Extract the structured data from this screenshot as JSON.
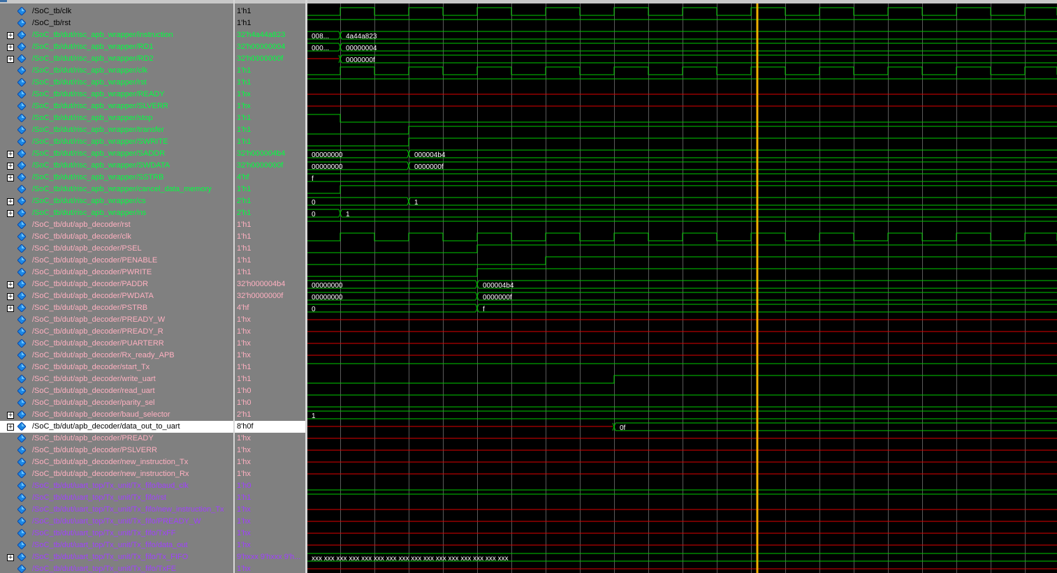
{
  "colors": {
    "high": "#00cc00",
    "low": "#00cc00",
    "x": "#e00000",
    "grid": "#5a5a5a",
    "cursor": "#f0b000",
    "bus": "#ffffff"
  },
  "icons": {
    "signal": "diamond-signal-icon",
    "expand": "plus-icon"
  },
  "expand_glyph": "+",
  "signals": [
    {
      "name": "/SoC_tb/clk",
      "value": "1'h1",
      "color": "#000000",
      "expandable": false,
      "wave": "clk"
    },
    {
      "name": "/SoC_tb/rst",
      "value": "1'h1",
      "color": "#000000",
      "expandable": false,
      "wave": "high"
    },
    {
      "name": "/SoC_tb/dut/risc_apb_wrapper/instruction",
      "value": "32'h4a44a823",
      "color": "#00ff40",
      "expandable": true,
      "wave": "bus",
      "labels": [
        "008...",
        "4a44a823"
      ]
    },
    {
      "name": "/SoC_tb/dut/risc_apb_wrapper/RD1",
      "value": "32'h00000004",
      "color": "#00ff40",
      "expandable": true,
      "wave": "bus",
      "labels": [
        "000...",
        "00000004"
      ]
    },
    {
      "name": "/SoC_tb/dut/risc_apb_wrapper/RD2",
      "value": "32'h0000000f",
      "color": "#00ff40",
      "expandable": true,
      "wave": "bus",
      "labels": [
        "",
        "0000000f"
      ]
    },
    {
      "name": "/SoC_tb/dut/risc_apb_wrapper/clk",
      "value": "1'h1",
      "color": "#00ff40",
      "expandable": false,
      "wave": "clk"
    },
    {
      "name": "/SoC_tb/dut/risc_apb_wrapper/rst",
      "value": "1'h1",
      "color": "#00ff40",
      "expandable": false,
      "wave": "high"
    },
    {
      "name": "/SoC_tb/dut/risc_apb_wrapper/READY",
      "value": "1'hx",
      "color": "#00ff40",
      "expandable": false,
      "wave": "x"
    },
    {
      "name": "/SoC_tb/dut/risc_apb_wrapper/SLVERR",
      "value": "1'hx",
      "color": "#00ff40",
      "expandable": false,
      "wave": "x"
    },
    {
      "name": "/SoC_tb/dut/risc_apb_wrapper/stop",
      "value": "1'h1",
      "color": "#00ff40",
      "expandable": false,
      "wave": "step"
    },
    {
      "name": "/SoC_tb/dut/risc_apb_wrapper/transfer",
      "value": "1'h1",
      "color": "#00ff40",
      "expandable": false,
      "wave": "step"
    },
    {
      "name": "/SoC_tb/dut/risc_apb_wrapper/SWRITE",
      "value": "1'h1",
      "color": "#00ff40",
      "expandable": false,
      "wave": "step"
    },
    {
      "name": "/SoC_tb/dut/risc_apb_wrapper/SADDR",
      "value": "32'h000004b4",
      "color": "#00ff40",
      "expandable": true,
      "wave": "bus",
      "labels": [
        "00000000",
        "000004b4"
      ]
    },
    {
      "name": "/SoC_tb/dut/risc_apb_wrapper/SWDATA",
      "value": "32'h0000000f",
      "color": "#00ff40",
      "expandable": true,
      "wave": "bus",
      "labels": [
        "00000000",
        "0000000f"
      ]
    },
    {
      "name": "/SoC_tb/dut/risc_apb_wrapper/SSTRB",
      "value": "4'hf",
      "color": "#00ff40",
      "expandable": true,
      "wave": "bus",
      "labels": [
        "f"
      ]
    },
    {
      "name": "/SoC_tb/dut/risc_apb_wrapper/cancel_data_memory",
      "value": "1'h1",
      "color": "#00ff40",
      "expandable": false,
      "wave": "step"
    },
    {
      "name": "/SoC_tb/dut/risc_apb_wrapper/cs",
      "value": "2'h1",
      "color": "#00ff40",
      "expandable": true,
      "wave": "bus",
      "labels": [
        "0",
        "1"
      ]
    },
    {
      "name": "/SoC_tb/dut/risc_apb_wrapper/ns",
      "value": "2'h1",
      "color": "#00ff40",
      "expandable": true,
      "wave": "bus",
      "labels": [
        "0",
        "1"
      ]
    },
    {
      "name": "/SoC_tb/dut/apb_decoder/rst",
      "value": "1'h1",
      "color": "#ffb0c0",
      "expandable": false,
      "wave": "high"
    },
    {
      "name": "/SoC_tb/dut/apb_decoder/clk",
      "value": "1'h1",
      "color": "#ffb0c0",
      "expandable": false,
      "wave": "clk"
    },
    {
      "name": "/SoC_tb/dut/apb_decoder/PSEL",
      "value": "1'h1",
      "color": "#ffb0c0",
      "expandable": false,
      "wave": "step"
    },
    {
      "name": "/SoC_tb/dut/apb_decoder/PENABLE",
      "value": "1'h1",
      "color": "#ffb0c0",
      "expandable": false,
      "wave": "step"
    },
    {
      "name": "/SoC_tb/dut/apb_decoder/PWRITE",
      "value": "1'h1",
      "color": "#ffb0c0",
      "expandable": false,
      "wave": "step"
    },
    {
      "name": "/SoC_tb/dut/apb_decoder/PADDR",
      "value": "32'h000004b4",
      "color": "#ffb0c0",
      "expandable": true,
      "wave": "bus",
      "labels": [
        "00000000",
        "000004b4"
      ]
    },
    {
      "name": "/SoC_tb/dut/apb_decoder/PWDATA",
      "value": "32'h0000000f",
      "color": "#ffb0c0",
      "expandable": true,
      "wave": "bus",
      "labels": [
        "00000000",
        "0000000f"
      ]
    },
    {
      "name": "/SoC_tb/dut/apb_decoder/PSTRB",
      "value": "4'hf",
      "color": "#ffb0c0",
      "expandable": true,
      "wave": "bus",
      "labels": [
        "0",
        "f"
      ]
    },
    {
      "name": "/SoC_tb/dut/apb_decoder/PREADY_W",
      "value": "1'hx",
      "color": "#ffb0c0",
      "expandable": false,
      "wave": "x"
    },
    {
      "name": "/SoC_tb/dut/apb_decoder/PREADY_R",
      "value": "1'hx",
      "color": "#ffb0c0",
      "expandable": false,
      "wave": "x"
    },
    {
      "name": "/SoC_tb/dut/apb_decoder/PUARTERR",
      "value": "1'hx",
      "color": "#ffb0c0",
      "expandable": false,
      "wave": "x"
    },
    {
      "name": "/SoC_tb/dut/apb_decoder/Rx_ready_APB",
      "value": "1'hx",
      "color": "#ffb0c0",
      "expandable": false,
      "wave": "x"
    },
    {
      "name": "/SoC_tb/dut/apb_decoder/start_Tx",
      "value": "1'h1",
      "color": "#ffb0c0",
      "expandable": false,
      "wave": "high"
    },
    {
      "name": "/SoC_tb/dut/apb_decoder/write_uart",
      "value": "1'h1",
      "color": "#ffb0c0",
      "expandable": false,
      "wave": "step"
    },
    {
      "name": "/SoC_tb/dut/apb_decoder/read_uart",
      "value": "1'h0",
      "color": "#ffb0c0",
      "expandable": false,
      "wave": "low"
    },
    {
      "name": "/SoC_tb/dut/apb_decoder/parity_sel",
      "value": "1'h0",
      "color": "#ffb0c0",
      "expandable": false,
      "wave": "low"
    },
    {
      "name": "/SoC_tb/dut/apb_decoder/baud_selector",
      "value": "2'h1",
      "color": "#ffb0c0",
      "expandable": true,
      "wave": "bus",
      "labels": [
        "1"
      ]
    },
    {
      "name": "/SoC_tb/dut/apb_decoder/data_out_to_uart",
      "value": "8'h0f",
      "color": "#000000",
      "expandable": true,
      "wave": "bus",
      "labels": [
        "",
        "0f"
      ],
      "selected": true
    },
    {
      "name": "/SoC_tb/dut/apb_decoder/PREADY",
      "value": "1'hx",
      "color": "#ffb0c0",
      "expandable": false,
      "wave": "x"
    },
    {
      "name": "/SoC_tb/dut/apb_decoder/PSLVERR",
      "value": "1'hx",
      "color": "#ffb0c0",
      "expandable": false,
      "wave": "x"
    },
    {
      "name": "/SoC_tb/dut/apb_decoder/new_instruction_Tx",
      "value": "1'hx",
      "color": "#ffb0c0",
      "expandable": false,
      "wave": "x"
    },
    {
      "name": "/SoC_tb/dut/apb_decoder/new_instruction_Rx",
      "value": "1'hx",
      "color": "#ffb0c0",
      "expandable": false,
      "wave": "x"
    },
    {
      "name": "/SoC_tb/dut/uart_top/Tx_unit/Tx_fifo/baud_clk",
      "value": "1'h0",
      "color": "#a040ff",
      "expandable": false,
      "wave": "low"
    },
    {
      "name": "/SoC_tb/dut/uart_top/Tx_unit/Tx_fifo/rst",
      "value": "1'h1",
      "color": "#a040ff",
      "expandable": false,
      "wave": "high"
    },
    {
      "name": "/SoC_tb/dut/uart_top/Tx_unit/Tx_fifo/new_instruction_Tx",
      "value": "1'hx",
      "color": "#a040ff",
      "expandable": false,
      "wave": "x"
    },
    {
      "name": "/SoC_tb/dut/uart_top/Tx_unit/Tx_fifo/PREADY_W",
      "value": "1'hx",
      "color": "#a040ff",
      "expandable": false,
      "wave": "x"
    },
    {
      "name": "/SoC_tb/dut/uart_top/Tx_unit/Tx_fifo/TxFF",
      "value": "1'hx",
      "color": "#a040ff",
      "expandable": false,
      "wave": "x"
    },
    {
      "name": "/SoC_tb/dut/uart_top/Tx_unit/Tx_fifo/data_out",
      "value": "1'hx",
      "color": "#a040ff",
      "expandable": false,
      "wave": "x"
    },
    {
      "name": "/SoC_tb/dut/uart_top/Tx_unit/Tx_fifo/Tx_FIFO",
      "value": "9'hxxx 9'hxxx 9'h...",
      "color": "#a040ff",
      "expandable": true,
      "wave": "bus",
      "labels": [
        "xxx xxx xxx xxx xxx xxx xxx xxx xxx xxx xxx xxx xxx xxx xxx xxx"
      ]
    },
    {
      "name": "/SoC_tb/dut/uart_top/Tx_unit/Tx_fifo/TxFE",
      "value": "1'hx",
      "color": "#a040ff",
      "expandable": false,
      "wave": "x"
    }
  ]
}
